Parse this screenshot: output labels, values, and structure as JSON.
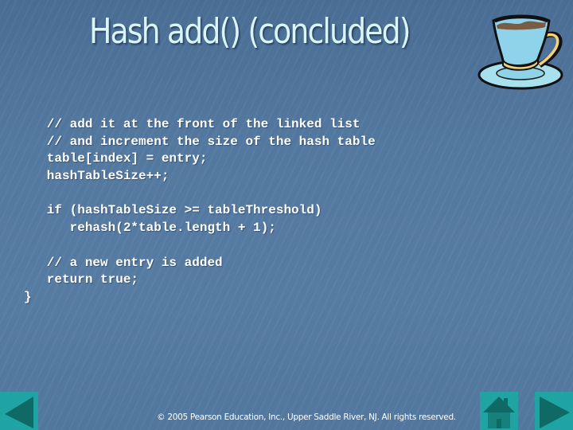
{
  "slide": {
    "title": "Hash add() (concluded)",
    "code_lines": [
      "   // add it at the front of the linked list",
      "   // and increment the size of the hash table",
      "   table[index] = entry;",
      "   hashTableSize++;",
      "",
      "   if (hashTableSize >= tableThreshold)",
      "      rehash(2*table.length + 1);",
      "",
      "   // a new entry is added",
      "   return true;",
      "}"
    ],
    "footer": "© 2005 Pearson Education, Inc., Upper Saddle River, NJ.  All rights reserved."
  },
  "nav": {
    "previous": {
      "icon": "left-triangle-icon"
    },
    "home": {
      "icon": "home-icon"
    },
    "next": {
      "icon": "right-triangle-icon"
    },
    "button_color": "#1fa3a3",
    "glyph_color": "#0f6a66"
  },
  "decoration": {
    "image": "teacup-clipart"
  }
}
